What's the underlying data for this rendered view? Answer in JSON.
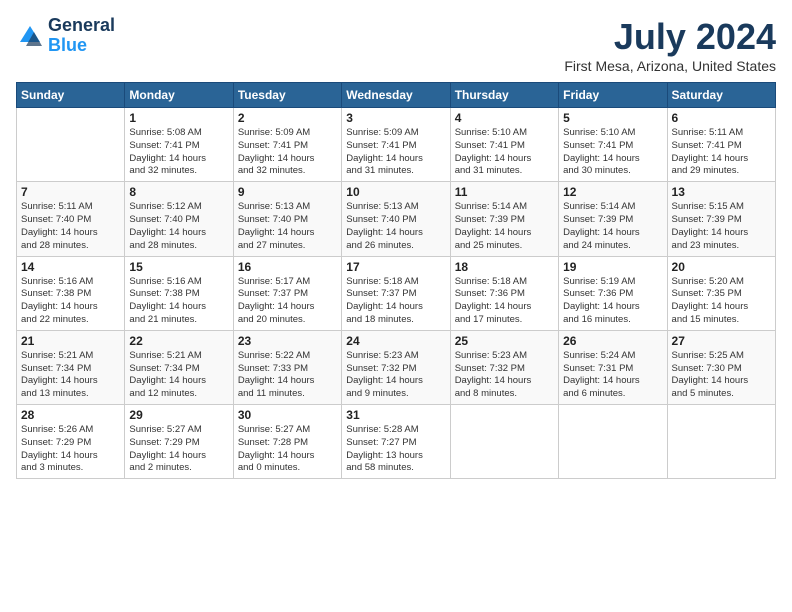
{
  "header": {
    "logo_line1": "General",
    "logo_line2": "Blue",
    "month": "July 2024",
    "location": "First Mesa, Arizona, United States"
  },
  "days_of_week": [
    "Sunday",
    "Monday",
    "Tuesday",
    "Wednesday",
    "Thursday",
    "Friday",
    "Saturday"
  ],
  "weeks": [
    [
      {
        "day": "",
        "info": ""
      },
      {
        "day": "1",
        "info": "Sunrise: 5:08 AM\nSunset: 7:41 PM\nDaylight: 14 hours\nand 32 minutes."
      },
      {
        "day": "2",
        "info": "Sunrise: 5:09 AM\nSunset: 7:41 PM\nDaylight: 14 hours\nand 32 minutes."
      },
      {
        "day": "3",
        "info": "Sunrise: 5:09 AM\nSunset: 7:41 PM\nDaylight: 14 hours\nand 31 minutes."
      },
      {
        "day": "4",
        "info": "Sunrise: 5:10 AM\nSunset: 7:41 PM\nDaylight: 14 hours\nand 31 minutes."
      },
      {
        "day": "5",
        "info": "Sunrise: 5:10 AM\nSunset: 7:41 PM\nDaylight: 14 hours\nand 30 minutes."
      },
      {
        "day": "6",
        "info": "Sunrise: 5:11 AM\nSunset: 7:41 PM\nDaylight: 14 hours\nand 29 minutes."
      }
    ],
    [
      {
        "day": "7",
        "info": "Sunrise: 5:11 AM\nSunset: 7:40 PM\nDaylight: 14 hours\nand 28 minutes."
      },
      {
        "day": "8",
        "info": "Sunrise: 5:12 AM\nSunset: 7:40 PM\nDaylight: 14 hours\nand 28 minutes."
      },
      {
        "day": "9",
        "info": "Sunrise: 5:13 AM\nSunset: 7:40 PM\nDaylight: 14 hours\nand 27 minutes."
      },
      {
        "day": "10",
        "info": "Sunrise: 5:13 AM\nSunset: 7:40 PM\nDaylight: 14 hours\nand 26 minutes."
      },
      {
        "day": "11",
        "info": "Sunrise: 5:14 AM\nSunset: 7:39 PM\nDaylight: 14 hours\nand 25 minutes."
      },
      {
        "day": "12",
        "info": "Sunrise: 5:14 AM\nSunset: 7:39 PM\nDaylight: 14 hours\nand 24 minutes."
      },
      {
        "day": "13",
        "info": "Sunrise: 5:15 AM\nSunset: 7:39 PM\nDaylight: 14 hours\nand 23 minutes."
      }
    ],
    [
      {
        "day": "14",
        "info": "Sunrise: 5:16 AM\nSunset: 7:38 PM\nDaylight: 14 hours\nand 22 minutes."
      },
      {
        "day": "15",
        "info": "Sunrise: 5:16 AM\nSunset: 7:38 PM\nDaylight: 14 hours\nand 21 minutes."
      },
      {
        "day": "16",
        "info": "Sunrise: 5:17 AM\nSunset: 7:37 PM\nDaylight: 14 hours\nand 20 minutes."
      },
      {
        "day": "17",
        "info": "Sunrise: 5:18 AM\nSunset: 7:37 PM\nDaylight: 14 hours\nand 18 minutes."
      },
      {
        "day": "18",
        "info": "Sunrise: 5:18 AM\nSunset: 7:36 PM\nDaylight: 14 hours\nand 17 minutes."
      },
      {
        "day": "19",
        "info": "Sunrise: 5:19 AM\nSunset: 7:36 PM\nDaylight: 14 hours\nand 16 minutes."
      },
      {
        "day": "20",
        "info": "Sunrise: 5:20 AM\nSunset: 7:35 PM\nDaylight: 14 hours\nand 15 minutes."
      }
    ],
    [
      {
        "day": "21",
        "info": "Sunrise: 5:21 AM\nSunset: 7:34 PM\nDaylight: 14 hours\nand 13 minutes."
      },
      {
        "day": "22",
        "info": "Sunrise: 5:21 AM\nSunset: 7:34 PM\nDaylight: 14 hours\nand 12 minutes."
      },
      {
        "day": "23",
        "info": "Sunrise: 5:22 AM\nSunset: 7:33 PM\nDaylight: 14 hours\nand 11 minutes."
      },
      {
        "day": "24",
        "info": "Sunrise: 5:23 AM\nSunset: 7:32 PM\nDaylight: 14 hours\nand 9 minutes."
      },
      {
        "day": "25",
        "info": "Sunrise: 5:23 AM\nSunset: 7:32 PM\nDaylight: 14 hours\nand 8 minutes."
      },
      {
        "day": "26",
        "info": "Sunrise: 5:24 AM\nSunset: 7:31 PM\nDaylight: 14 hours\nand 6 minutes."
      },
      {
        "day": "27",
        "info": "Sunrise: 5:25 AM\nSunset: 7:30 PM\nDaylight: 14 hours\nand 5 minutes."
      }
    ],
    [
      {
        "day": "28",
        "info": "Sunrise: 5:26 AM\nSunset: 7:29 PM\nDaylight: 14 hours\nand 3 minutes."
      },
      {
        "day": "29",
        "info": "Sunrise: 5:27 AM\nSunset: 7:29 PM\nDaylight: 14 hours\nand 2 minutes."
      },
      {
        "day": "30",
        "info": "Sunrise: 5:27 AM\nSunset: 7:28 PM\nDaylight: 14 hours\nand 0 minutes."
      },
      {
        "day": "31",
        "info": "Sunrise: 5:28 AM\nSunset: 7:27 PM\nDaylight: 13 hours\nand 58 minutes."
      },
      {
        "day": "",
        "info": ""
      },
      {
        "day": "",
        "info": ""
      },
      {
        "day": "",
        "info": ""
      }
    ]
  ]
}
